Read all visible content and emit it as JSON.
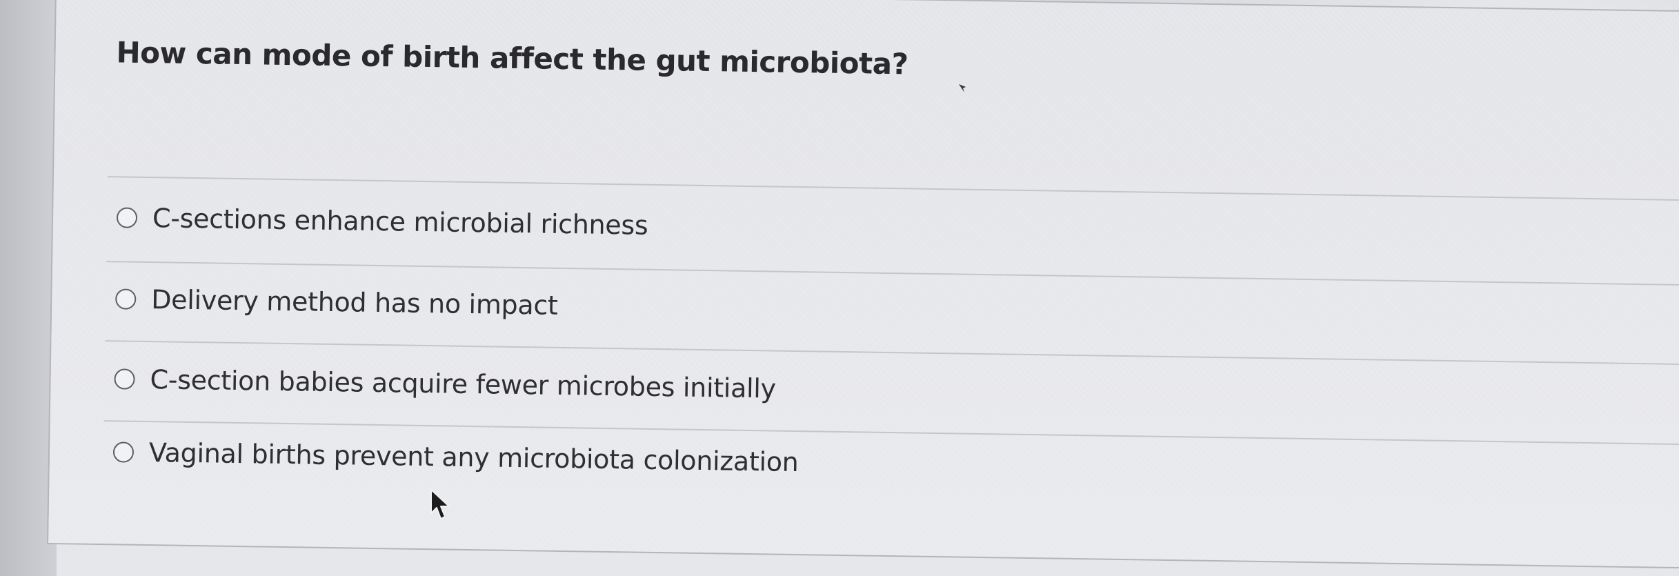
{
  "question": {
    "text": "How can mode of birth affect the gut microbiota?"
  },
  "options": [
    {
      "label": "C-sections enhance microbial richness",
      "selected": false
    },
    {
      "label": "Delivery method has no impact",
      "selected": false
    },
    {
      "label": "C-section babies acquire fewer microbes initially",
      "selected": false
    },
    {
      "label": "Vaginal births prevent any microbiota colonization",
      "selected": false
    }
  ],
  "icons": {
    "pointer": "mouse-pointer-icon",
    "radio": "radio-button-unchecked-icon"
  },
  "colors": {
    "text": "#2f2f33",
    "radio_border": "#5d5e63",
    "divider": "#c5c6cb",
    "card_background": "#e6e7ea"
  }
}
